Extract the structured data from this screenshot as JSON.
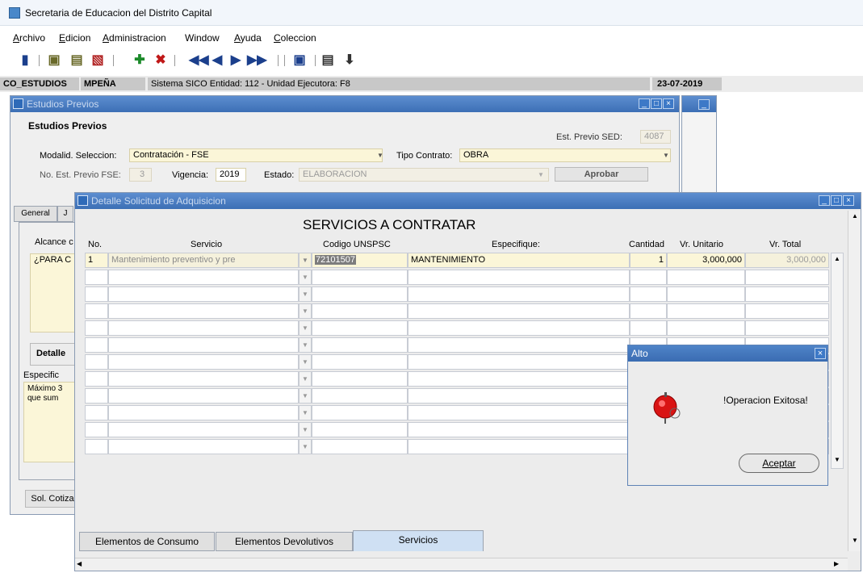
{
  "window": {
    "title": "Secretaria de Educacion del Distrito Capital"
  },
  "menu": [
    {
      "label": "Archivo",
      "u": "A"
    },
    {
      "label": "Edicion",
      "u": "E"
    },
    {
      "label": "Administracion",
      "u": "A"
    },
    {
      "label": "Window",
      "u": ""
    },
    {
      "label": "Ayuda",
      "u": "A"
    },
    {
      "label": "Coleccion",
      "u": "C"
    }
  ],
  "toolbar_icons": [
    "exit-icon",
    "query-icon",
    "enter-query-icon",
    "cancel-query-icon",
    "insert-record-icon",
    "delete-record-icon",
    "first-record-icon",
    "previous-record-icon",
    "next-record-icon",
    "last-record-icon",
    "save-icon",
    "print-icon",
    "download-icon"
  ],
  "status": {
    "form": "CO_ESTUDIOS",
    "user": "MPEÑA",
    "system": "Sistema SICO  Entidad: 112 - Unidad Ejecutora: F8",
    "date": "23-07-2019"
  },
  "estudios": {
    "title": "Estudios Previos",
    "section": "Estudios Previos",
    "est_previo_sed_label": "Est. Previo SED:",
    "est_previo_sed_value": "4087",
    "modalidad_label": "Modalid. Seleccion:",
    "modalidad_value": "Contratación - FSE",
    "tipo_contrato_label": "Tipo Contrato:",
    "tipo_contrato_value": "OBRA",
    "no_est_label": "No. Est. Previo FSE:",
    "no_est_value": "3",
    "vigencia_label": "Vigencia:",
    "vigencia_value": "2019",
    "estado_label": "Estado:",
    "estado_value": "ELABORACION",
    "aprobar_label": "Aprobar",
    "tab_general": "General",
    "tab_j": "J",
    "alcance_label": "Alcance c",
    "alcance_value": "¿PARA C",
    "detalle_label": "Detalle",
    "especific_label": "Especific",
    "especific_value1": "Máximo 3",
    "especific_value2": "que sum",
    "sol_cotiz_label": "Sol. Cotiza"
  },
  "detalle": {
    "title": "Detalle Solicitud de Adquisicion",
    "heading": "SERVICIOS A CONTRATAR",
    "columns": {
      "no": "No.",
      "servicio": "Servicio",
      "codigo": "Codigo UNSPSC",
      "especifique": "Especifique:",
      "cantidad": "Cantidad",
      "vr_unitario": "Vr. Unitario",
      "vr_total": "Vr. Total"
    },
    "row1": {
      "no": "1",
      "servicio": "Mantenimiento preventivo y pre",
      "codigo": "72101507",
      "especifique": "MANTENIMIENTO",
      "cantidad": "1",
      "vr_unitario": "3,000,000",
      "vr_total": "3,000,000"
    },
    "tabs": {
      "consumo": "Elementos de Consumo",
      "devolutivos": "Elementos Devolutivos",
      "servicios": "Servicios"
    }
  },
  "alert": {
    "title": "Alto",
    "message": "!Operacion Exitosa!",
    "ok_label": "Aceptar"
  },
  "colors": {
    "title_bar": "#3c6fb5",
    "field_bg": "#fbf6d8",
    "alert_title": "#3f73ba"
  }
}
